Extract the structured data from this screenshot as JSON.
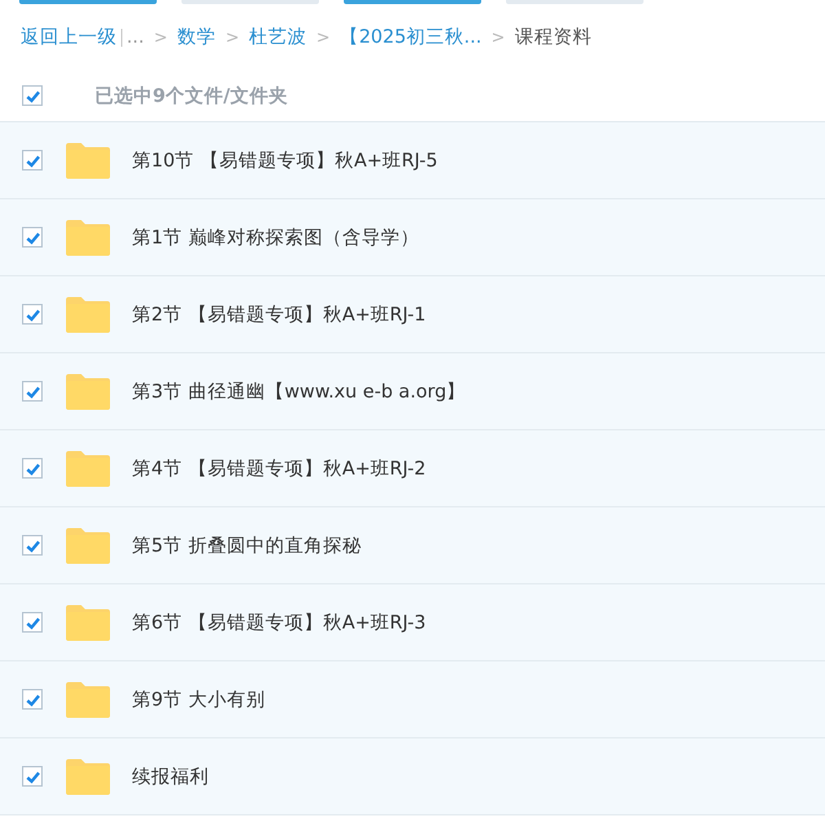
{
  "breadcrumb": {
    "back": "返回上一级",
    "items": [
      {
        "label": "...",
        "kind": "ellipsis"
      },
      {
        "label": "数学",
        "kind": "link",
        "separator": ">"
      },
      {
        "label": "杜艺波",
        "kind": "link",
        "separator": ">"
      },
      {
        "label": "【2025初三秋...",
        "kind": "link",
        "separator": ">"
      },
      {
        "label": "课程资料",
        "kind": "current",
        "separator": ">"
      }
    ]
  },
  "select_all": {
    "checked": true,
    "label": "已选中9个文件/文件夹"
  },
  "files": [
    {
      "name": "第10节 【易错题专项】秋A+班RJ-5",
      "checked": true
    },
    {
      "name": "第1节 巅峰对称探索图（含导学）",
      "checked": true
    },
    {
      "name": "第2节 【易错题专项】秋A+班RJ-1",
      "checked": true
    },
    {
      "name": "第3节 曲径通幽【www.xu e-b a.org】",
      "checked": true
    },
    {
      "name": "第4节 【易错题专项】秋A+班RJ-2",
      "checked": true
    },
    {
      "name": "第5节 折叠圆中的直角探秘",
      "checked": true
    },
    {
      "name": "第6节 【易错题专项】秋A+班RJ-3",
      "checked": true
    },
    {
      "name": "第9节 大小有别",
      "checked": true
    },
    {
      "name": "续报福利",
      "checked": true
    }
  ]
}
